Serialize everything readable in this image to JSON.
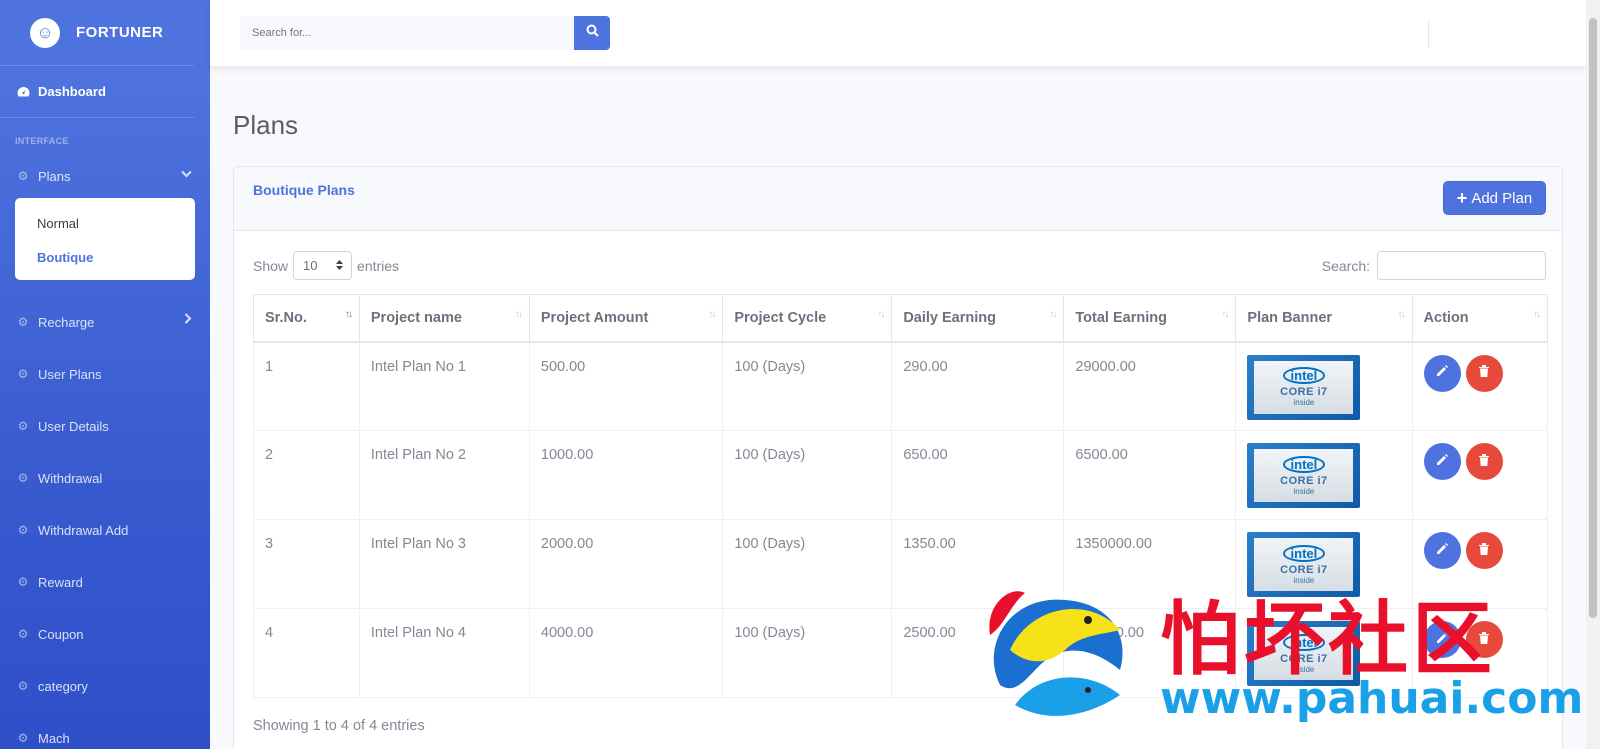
{
  "sidebar": {
    "brand": "FORTUNER",
    "dashboard": "Dashboard",
    "heading": "INTERFACE",
    "plans": "Plans",
    "submenu": [
      "Normal",
      "Boutique"
    ],
    "items": [
      "Recharge",
      "User Plans",
      "User Details",
      "Withdrawal",
      "Withdrawal Add",
      "Reward",
      "Coupon",
      "category",
      "Mach"
    ]
  },
  "topbar": {
    "search_placeholder": "Search for..."
  },
  "page": {
    "title": "Plans"
  },
  "card": {
    "title": "Boutique Plans",
    "add_button": "Add Plan"
  },
  "datatable": {
    "show": "Show",
    "length": "10",
    "entries": "entries",
    "search_label": "Search:",
    "columns": [
      "Sr.No.",
      "Project name",
      "Project Amount",
      "Project Cycle",
      "Daily Earning",
      "Total Earning",
      "Plan Banner",
      "Action"
    ],
    "rows": [
      [
        "1",
        "Intel Plan No 1",
        "500.00",
        "100 (Days)",
        "290.00",
        "29000.00"
      ],
      [
        "2",
        "Intel Plan No 2",
        "1000.00",
        "100 (Days)",
        "650.00",
        "6500.00"
      ],
      [
        "3",
        "Intel Plan No 3",
        "2000.00",
        "100 (Days)",
        "1350.00",
        "1350000.00"
      ],
      [
        "4",
        "Intel Plan No 4",
        "4000.00",
        "100 (Days)",
        "2500.00",
        "250000.00"
      ]
    ],
    "banner": {
      "brand": "intel",
      "line1": "CORE i7",
      "line2": "inside"
    },
    "info": "Showing 1 to 4 of 4 entries"
  },
  "watermark": {
    "text": "怕坏社区",
    "url": "www.pahuai.com"
  },
  "colors": {
    "primary": "#4e73df",
    "danger": "#e74a3b"
  }
}
